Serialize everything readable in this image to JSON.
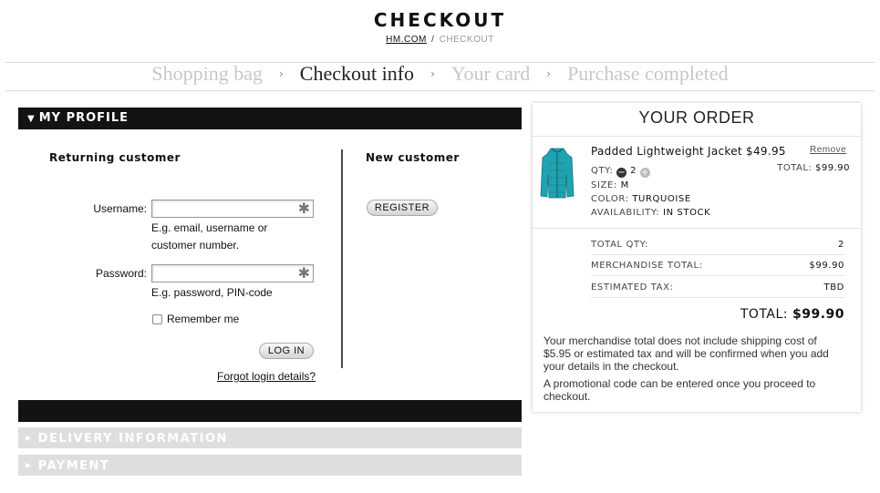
{
  "header": {
    "title": "CHECKOUT",
    "breadcrumb_home": "HM.COM",
    "breadcrumb_sep": "/",
    "breadcrumb_current": "CHECKOUT"
  },
  "steps": {
    "items": [
      "Shopping bag",
      "Checkout info",
      "Your card",
      "Purchase completed"
    ],
    "active_index": 1,
    "separator": "›"
  },
  "profile": {
    "title": "MY PROFILE",
    "returning": {
      "heading": "Returning customer",
      "username_label": "Username:",
      "username_hint_1": "E.g. email, username or",
      "username_hint_2": "customer number.",
      "password_label": "Password:",
      "password_hint": "E.g. password, PIN-code",
      "required_mark": "✱",
      "remember_label": "Remember me",
      "remember_checked": false,
      "login_button": "LOG IN",
      "forgot_link": "Forgot login details?"
    },
    "new_customer": {
      "heading": "New customer",
      "register_button": "REGISTER"
    }
  },
  "sections": {
    "delivery": "DELIVERY INFORMATION",
    "payment": "PAYMENT"
  },
  "order": {
    "title": "YOUR ORDER",
    "item": {
      "name": "Padded Lightweight Jacket",
      "price": "$49.95",
      "remove": "Remove",
      "qty_label": "QTY:",
      "qty": "2",
      "total_label": "TOTAL:",
      "total": "$99.90",
      "size_label": "SIZE:",
      "size": "M",
      "color_label": "COLOR:",
      "color": "TURQUOISE",
      "availability_label": "AVAILABILITY:",
      "availability": "IN STOCK",
      "image_color": "#1fa3b0"
    },
    "summary": {
      "total_qty_label": "TOTAL QTY:",
      "total_qty": "2",
      "merch_label": "MERCHANDISE TOTAL:",
      "merch": "$99.90",
      "tax_label": "ESTIMATED TAX:",
      "tax": "TBD",
      "grand_label": "TOTAL:",
      "grand": "$99.90"
    },
    "note_shipping": "Your merchandise total does not include shipping cost of $5.95 or estimated tax and will be confirmed when you add your details in the checkout.",
    "note_promo": "A promotional code can be entered once you proceed to checkout."
  }
}
